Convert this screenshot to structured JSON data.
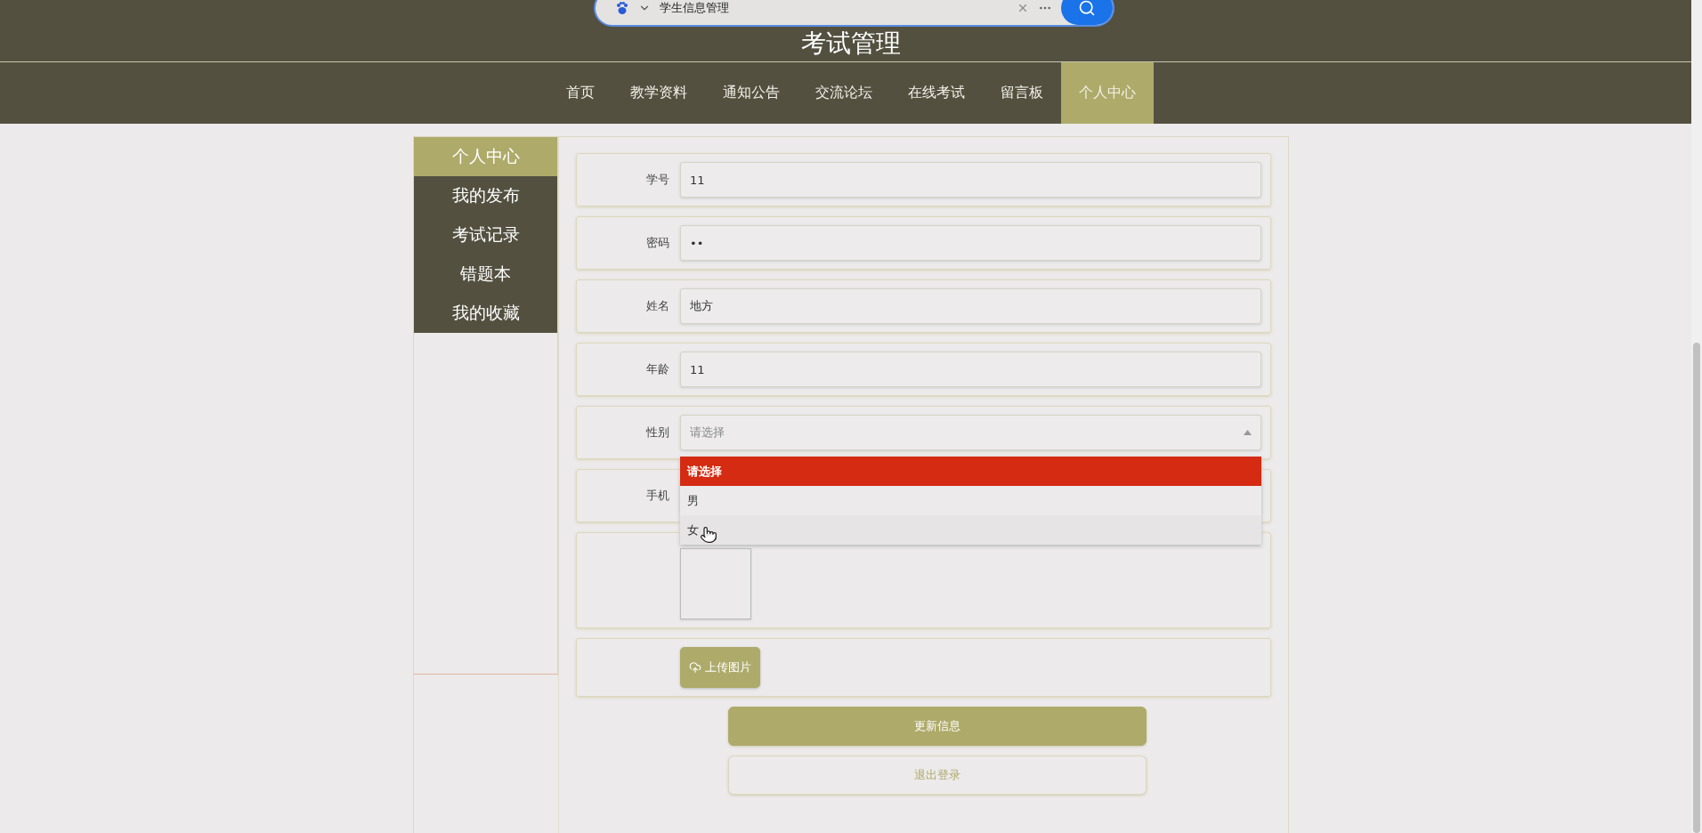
{
  "header": {
    "title": "考试管理"
  },
  "browser_search": {
    "value": "学生信息管理"
  },
  "nav": [
    {
      "label": "首页",
      "selected": false
    },
    {
      "label": "教学资料",
      "selected": false
    },
    {
      "label": "通知公告",
      "selected": false
    },
    {
      "label": "交流论坛",
      "selected": false
    },
    {
      "label": "在线考试",
      "selected": false
    },
    {
      "label": "留言板",
      "selected": false
    },
    {
      "label": "个人中心",
      "selected": true
    }
  ],
  "sidebar": [
    {
      "label": "个人中心",
      "selected": true
    },
    {
      "label": "我的发布",
      "selected": false
    },
    {
      "label": "考试记录",
      "selected": false
    },
    {
      "label": "错题本",
      "selected": false
    },
    {
      "label": "我的收藏",
      "selected": false
    }
  ],
  "form": [
    {
      "kind": "text",
      "label": "学号",
      "value": "11"
    },
    {
      "kind": "text",
      "label": "密码",
      "value": "••"
    },
    {
      "kind": "text",
      "label": "姓名",
      "value": "地方"
    },
    {
      "kind": "text",
      "label": "年龄",
      "value": "11"
    },
    {
      "kind": "select",
      "label": "性别",
      "placeholder": "请选择",
      "expanded": true,
      "options": [
        {
          "label": "请选择",
          "selected": true,
          "hovered": false
        },
        {
          "label": "男",
          "selected": false,
          "hovered": false
        },
        {
          "label": "女",
          "selected": false,
          "hovered": true
        }
      ]
    },
    {
      "kind": "text",
      "label": "手机"
    },
    {
      "kind": "image"
    },
    {
      "kind": "upload",
      "button": "上传图片"
    }
  ],
  "buttons": [
    {
      "kind": "primary",
      "label": "更新信息"
    },
    {
      "kind": "secondary",
      "label": "退出登录"
    }
  ]
}
